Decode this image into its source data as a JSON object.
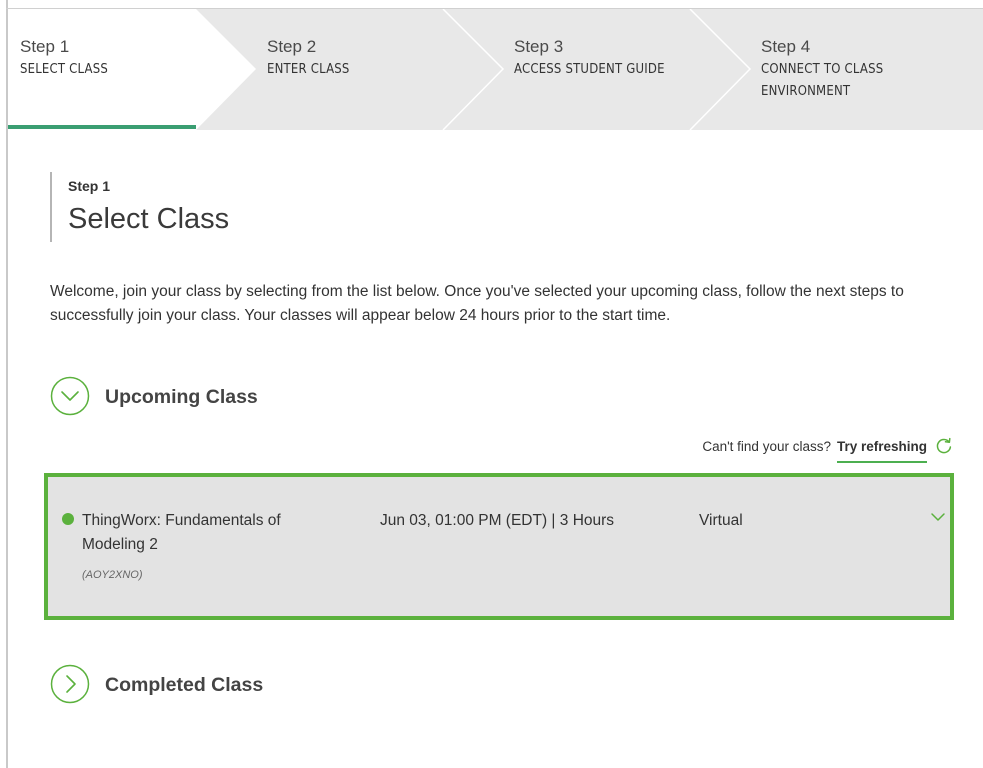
{
  "stepper": {
    "steps": [
      {
        "number": "Step 1",
        "label": "SELECT CLASS",
        "active": true
      },
      {
        "number": "Step 2",
        "label": "ENTER CLASS"
      },
      {
        "number": "Step 3",
        "label": "ACCESS STUDENT GUIDE"
      },
      {
        "number": "Step 4",
        "label": "CONNECT TO CLASS ENVIRONMENT"
      }
    ]
  },
  "heading": {
    "step": "Step 1",
    "title": "Select Class"
  },
  "intro": "Welcome, join your class by selecting from the list below. Once you've selected your upcoming class, follow the next steps to successfully join your class. Your classes will appear below 24 hours prior to the start time.",
  "upcoming": {
    "title": "Upcoming Class",
    "refresh_prompt": "Can't find your class?",
    "refresh_link": "Try refreshing",
    "classes": [
      {
        "name": "ThingWorx: Fundamentals of Modeling 2",
        "code": "(AOY2XNO)",
        "when": "Jun 03, 01:00 PM (EDT) | 3 Hours",
        "type": "Virtual"
      }
    ]
  },
  "completed": {
    "title": "Completed Class"
  },
  "colors": {
    "accent_green": "#5bb13d",
    "active_step_bar": "#3a9e72",
    "stepper_bg": "#e8e8e8",
    "card_bg": "#e3e3e3"
  },
  "icons": {
    "expand": "chevron-down-icon",
    "collapse": "chevron-right-icon",
    "refresh": "refresh-icon"
  }
}
